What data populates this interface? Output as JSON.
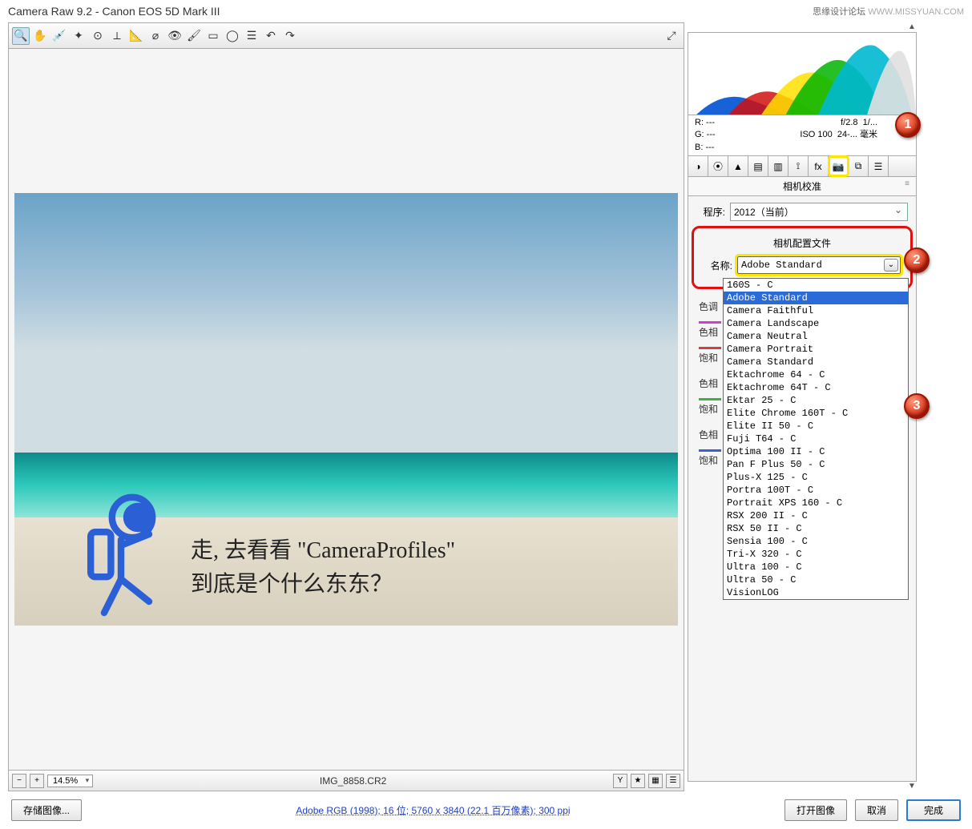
{
  "window": {
    "title": "Camera Raw 9.2  -  Canon EOS 5D Mark III",
    "watermark_cn": "思缘设计论坛",
    "watermark_url": "WWW.MISSYUAN.COM"
  },
  "preview": {
    "filename": "IMG_8858.CR2",
    "zoom": "14.5%",
    "overlay_text_line1": "走, 去看看 \"CameraProfiles\"",
    "overlay_text_line2": "到底是个什么东东？"
  },
  "info": {
    "r": "R:  ---",
    "g": "G:  ---",
    "b": "B:  ---",
    "aperture": "f/2.8",
    "shutter": "1/...",
    "iso": "ISO 100",
    "focal": "24-... 毫米"
  },
  "panel": {
    "title": "相机校准",
    "process_label": "程序:",
    "process_value": "2012（当前）",
    "profile_section_title": "相机配置文件",
    "name_label": "名称:",
    "name_value": "Adobe Standard",
    "options": [
      "160S - C",
      "Adobe Standard",
      "Camera Faithful",
      "Camera Landscape",
      "Camera Neutral",
      "Camera Portrait",
      "Camera Standard",
      "Ektachrome 64 - C",
      "Ektachrome 64T - C",
      "Ektar 25 - C",
      "Elite Chrome 160T - C",
      "Elite II 50 - C",
      "Fuji T64 - C",
      "Optima 100 II - C",
      "Pan F Plus 50 - C",
      "Plus-X 125 - C",
      "Portra 100T - C",
      "Portrait XPS 160 - C",
      "RSX 200 II - C",
      "RSX 50 II - C",
      "Sensia 100  - C",
      "Tri-X 320 - C",
      "Ultra 100 - C",
      "Ultra 50 - C",
      "VisionLOG"
    ],
    "selected_option": "Adobe Standard",
    "hidden_labels": [
      "色调",
      "色相",
      "饱和度",
      "色相",
      "饱和度",
      "色相",
      "饱和度"
    ]
  },
  "footer": {
    "save_image": "存储图像...",
    "info": "Adobe RGB (1998); 16 位;  5760 x 3840 (22.1 百万像素); 300 ppi",
    "open_image": "打开图像",
    "cancel": "取消",
    "done": "完成"
  },
  "callouts": {
    "c1": "1",
    "c2": "2",
    "c3": "3"
  }
}
